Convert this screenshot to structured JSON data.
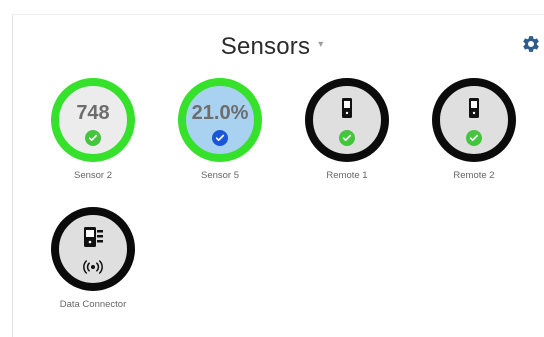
{
  "page": {
    "title": "Sensors",
    "title_dropdown_icon": "caret-down-icon",
    "settings_icon": "gear-icon"
  },
  "sensors": [
    {
      "name": "Sensor 2",
      "value": "748",
      "status": "ok",
      "status_icon": "check-icon",
      "ring_color": "#35e12b",
      "selected": false
    },
    {
      "name": "Sensor 5",
      "value": "21.0%",
      "status": "selected",
      "status_icon": "check-icon",
      "ring_color": "#35e12b",
      "selected": true
    },
    {
      "name": "Remote 1",
      "value": "",
      "status": "ok",
      "status_icon": "check-icon",
      "device_icon": "remote-device-icon",
      "ring_color": "#0b0b0b",
      "selected": false
    },
    {
      "name": "Remote 2",
      "value": "",
      "status": "ok",
      "status_icon": "check-icon",
      "device_icon": "remote-device-icon",
      "ring_color": "#0b0b0b",
      "selected": false
    },
    {
      "name": "Data Connector",
      "value": "",
      "status": "connected",
      "status_icon": "wireless-signal-icon",
      "device_icon": "data-connector-icon",
      "ring_color": "#0b0b0b",
      "selected": false
    }
  ],
  "colors": {
    "ok_green": "#35e12b",
    "check_green": "#45c53d",
    "selected_blue": "#1a57d8",
    "selected_fill": "#a8d2ef",
    "remote_black": "#0b0b0b"
  }
}
